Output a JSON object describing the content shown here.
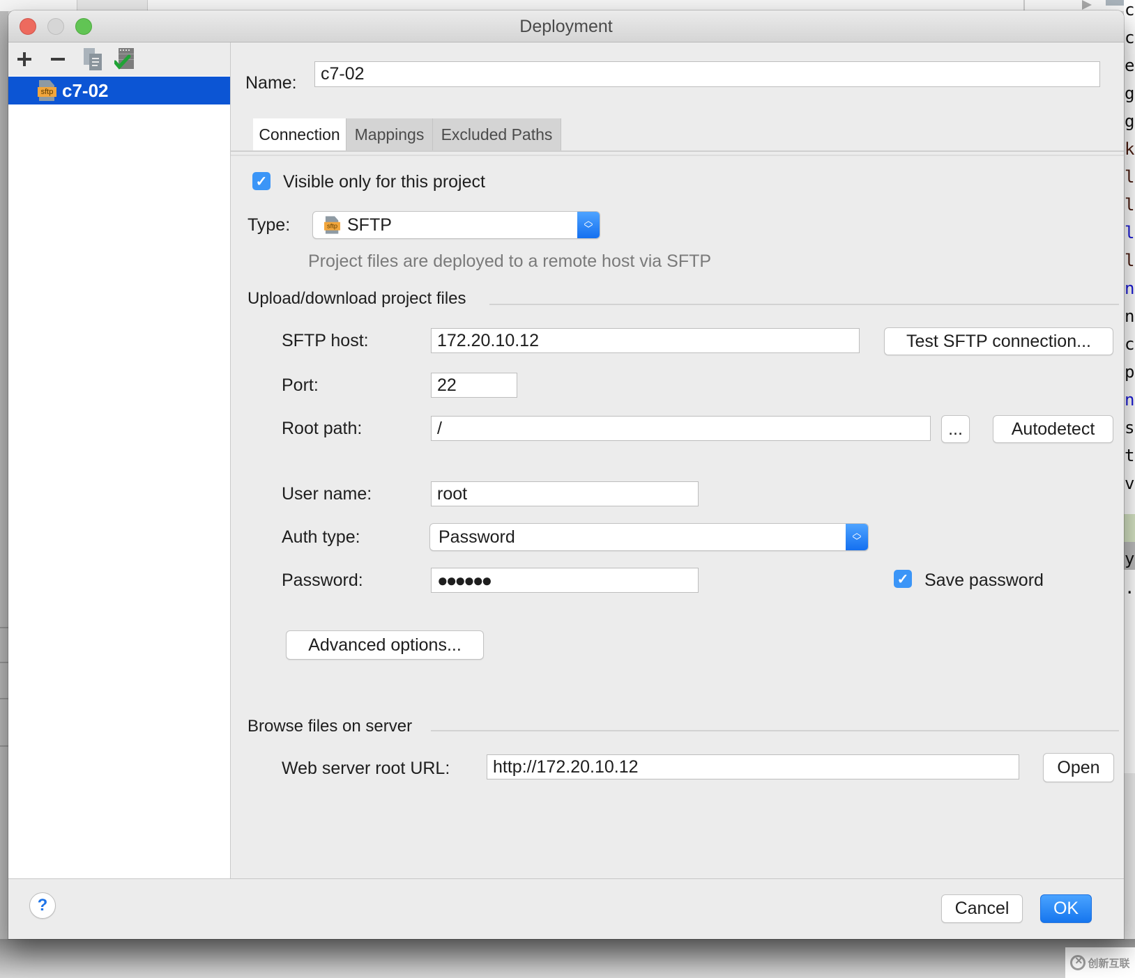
{
  "window": {
    "title": "Deployment"
  },
  "sidebar": {
    "toolbar": {
      "add_icon": "plus-icon",
      "remove_icon": "minus-icon",
      "copy_icon": "copy-icon",
      "default_icon": "server-check-icon"
    },
    "items": [
      {
        "label": "c7-02",
        "icon": "sftp-icon",
        "icon_text": "sftp",
        "selected": true
      }
    ]
  },
  "form": {
    "name_label": "Name:",
    "name_value": "c7-02",
    "tabs": [
      {
        "label": "Connection",
        "active": true
      },
      {
        "label": "Mappings",
        "active": false
      },
      {
        "label": "Excluded Paths",
        "active": false
      }
    ],
    "visible_only_label": "Visible only for this project",
    "visible_only_checked": true,
    "type_label": "Type:",
    "type_value": "SFTP",
    "type_icon_text": "sftp",
    "type_description": "Project files are deployed to a remote host via SFTP",
    "upload_group_title": "Upload/download project files",
    "host_label": "SFTP host:",
    "host_value": "172.20.10.12",
    "test_button": "Test SFTP connection...",
    "port_label": "Port:",
    "port_value": "22",
    "root_path_label": "Root path:",
    "root_path_value": "/",
    "browse_button": "...",
    "autodetect_button": "Autodetect",
    "username_label": "User name:",
    "username_value": "root",
    "auth_type_label": "Auth type:",
    "auth_type_value": "Password",
    "password_label": "Password:",
    "password_mask": "●●●●●●",
    "save_password_label": "Save password",
    "save_password_checked": true,
    "advanced_button": "Advanced options...",
    "browse_group_title": "Browse files on server",
    "web_root_label": "Web server root URL:",
    "web_root_value": "http://172.20.10.12",
    "open_button": "Open"
  },
  "footer": {
    "help_label": "?",
    "cancel_label": "Cancel",
    "ok_label": "OK"
  },
  "background": {
    "editor_letters": [
      "c",
      "c",
      "e",
      "g",
      "g",
      "k",
      "l",
      "l",
      "l",
      "l",
      "n",
      "n",
      "c",
      "p",
      "n",
      "s",
      "t",
      "v",
      "y",
      "."
    ],
    "editor_letter_colors": [
      "#111",
      "#111",
      "#111",
      "#111",
      "#111",
      "#4a1c10",
      "#4a1c10",
      "#4a1c10",
      "#1a1ad6",
      "#4a1c10",
      "#1a1ad6",
      "#111",
      "#111",
      "#111",
      "#1a1ad6",
      "#111",
      "#111",
      "#111",
      "#111",
      "#111"
    ]
  },
  "watermark": {
    "text": "创新互联"
  },
  "colors": {
    "selection": "#0c55d4",
    "accent": "#1676ee",
    "checkbox": "#3b95f7"
  }
}
